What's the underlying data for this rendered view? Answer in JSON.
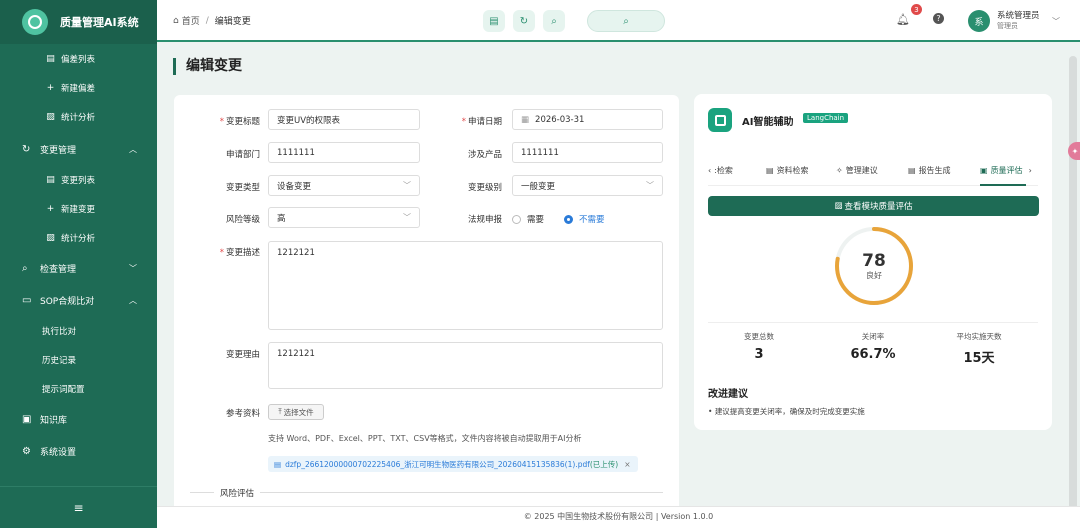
{
  "app": {
    "title": "质量管理AI系统"
  },
  "sidebar": {
    "top_items": [
      {
        "label": "偏差列表",
        "icon": "doc-icon"
      },
      {
        "label": "新建偏差",
        "icon": "plus-icon"
      },
      {
        "label": "统计分析",
        "icon": "chart-icon"
      }
    ],
    "change_group": {
      "label": "变更管理",
      "expanded": true
    },
    "change_items": [
      {
        "label": "变更列表",
        "icon": "doc-icon"
      },
      {
        "label": "新建变更",
        "icon": "plus-icon"
      },
      {
        "label": "统计分析",
        "icon": "chart-icon"
      }
    ],
    "inspect_group": {
      "label": "检查管理"
    },
    "sop_group": {
      "label": "SOP合规比对",
      "expanded": true
    },
    "sop_items": [
      "执行比对",
      "历史记录",
      "提示词配置"
    ],
    "kb": {
      "label": "知识库"
    },
    "settings": {
      "label": "系统设置"
    }
  },
  "header": {
    "breadcrumb_home": "首页",
    "breadcrumb_sep": "/",
    "breadcrumb_current": "编辑变更",
    "notifications": "3",
    "help": "?",
    "user_avatar": "系",
    "user_name": "系统管理员",
    "user_role": "管理员"
  },
  "page": {
    "title": "编辑变更"
  },
  "form": {
    "title_label": "变更标题",
    "title_value": "变更UV的权限表",
    "date_label": "申请日期",
    "date_value": "2026-03-31",
    "dept_label": "申请部门",
    "dept_value": "1111111",
    "product_label": "涉及产品",
    "product_value": "1111111",
    "type_label": "变更类型",
    "type_value": "设备变更",
    "level_label": "变更级别",
    "level_value": "一般变更",
    "risk_label": "风险等级",
    "risk_value": "高",
    "reg_label": "法规申报",
    "reg_opt1": "需要",
    "reg_opt2": "不需要",
    "reg_selected": "不需要",
    "desc_label": "变更描述",
    "desc_value": "1212121",
    "reason_label": "变更理由",
    "reason_value": "1212121",
    "ref_label": "参考资料",
    "upload_label": "选择文件",
    "hint": "支持 Word、PDF、Excel、PPT、TXT、CSV等格式，文件内容将被自动提取用于AI分析",
    "file_name": "dzfp_26612000000702225406_浙江可明生物医药有限公司_20260415135836(1).pdf",
    "file_status": "(已上传)",
    "risk_section": "风险评估"
  },
  "ai": {
    "title": "AI智能辅助",
    "tag": "LangChain",
    "tabs": [
      ":检索",
      "资料检索",
      "管理建议",
      "报告生成",
      "质量评估"
    ],
    "active_tab": "质量评估",
    "view_button": "查看模块质量评估",
    "score": "78",
    "score_value": 78,
    "score_label": "良好",
    "stats": [
      {
        "label": "变更总数",
        "value": "3"
      },
      {
        "label": "关闭率",
        "value": "66.7%"
      },
      {
        "label": "平均实施天数",
        "value": "15天"
      }
    ],
    "suggestions_title": "改进建议",
    "suggestions": [
      "建议提高变更关闭率，确保及时完成变更实施"
    ]
  },
  "footer": {
    "text": "© 2025 中国生物技术股份有限公司 | Version 1.0.0"
  }
}
